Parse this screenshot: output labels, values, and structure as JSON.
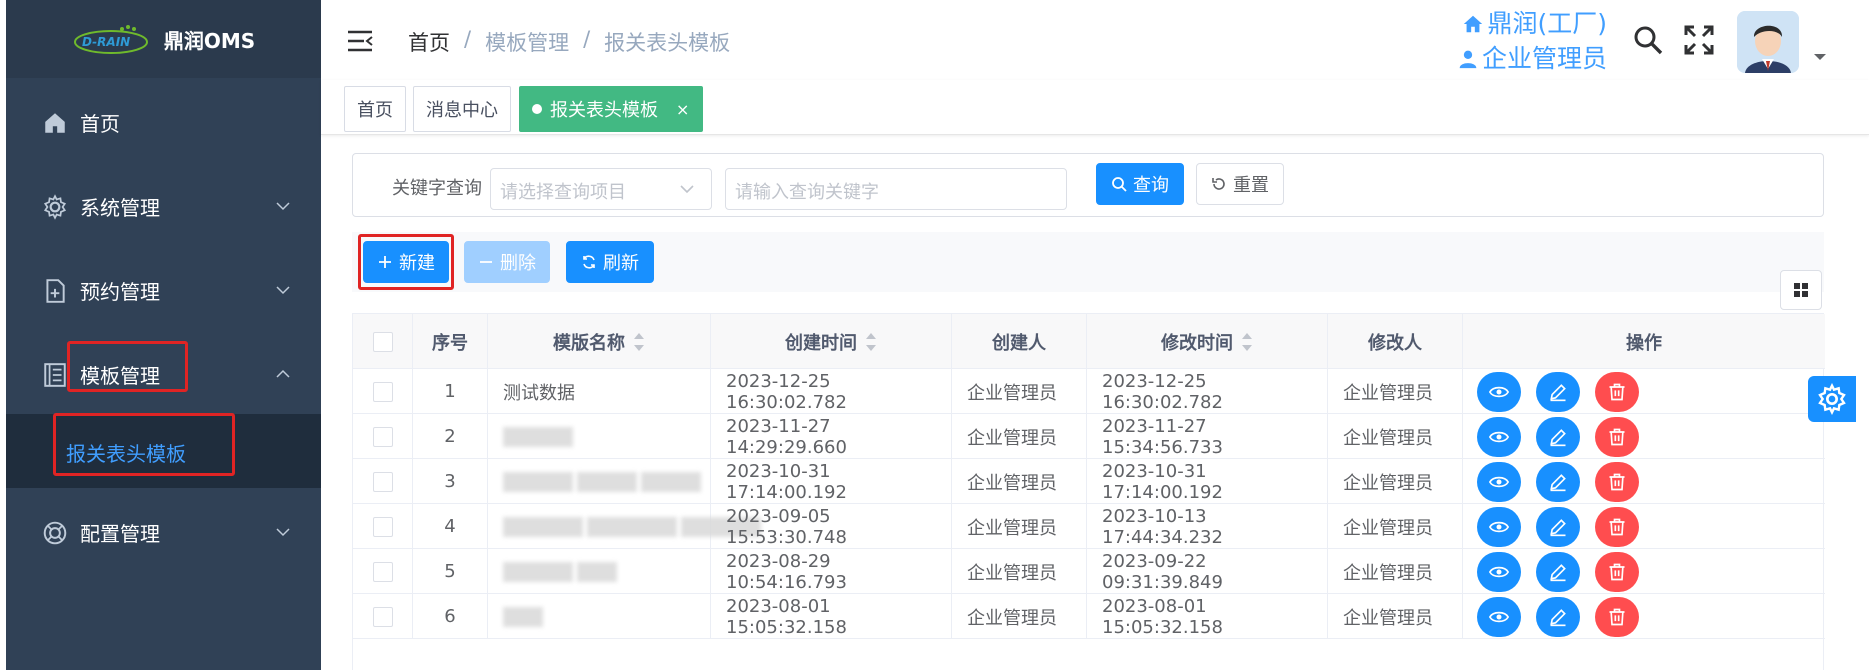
{
  "brand": {
    "logo_text": "D-RAIN",
    "app_name": "鼎润OMS"
  },
  "sidebar": {
    "items": [
      {
        "label": "首页",
        "icon": "home-icon"
      },
      {
        "label": "系统管理",
        "icon": "gear-icon"
      },
      {
        "label": "预约管理",
        "icon": "file-plus-icon"
      },
      {
        "label": "模板管理",
        "icon": "document-icon",
        "expanded": true
      },
      {
        "label": "配置管理",
        "icon": "config-icon"
      }
    ],
    "submenu": {
      "label": "报关表头模板",
      "active": true
    }
  },
  "header": {
    "breadcrumb": [
      "首页",
      "/",
      "模板管理",
      "/",
      "报关表头模板"
    ],
    "company": "鼎润(工厂)",
    "role": "企业管理员"
  },
  "tags": [
    {
      "label": "首页",
      "active": false
    },
    {
      "label": "消息中心",
      "active": false
    },
    {
      "label": "报关表头模板",
      "active": true,
      "close": "×"
    }
  ],
  "search": {
    "label": "关键字查询",
    "select_placeholder": "请选择查询项目",
    "input_placeholder": "请输入查询关键字",
    "query_label": "查询",
    "reset_label": "重置"
  },
  "toolbar": {
    "new_label": "新建",
    "delete_label": "删除",
    "refresh_label": "刷新"
  },
  "table": {
    "columns": [
      "",
      "序号",
      "模版名称",
      "创建时间",
      "创建人",
      "修改时间",
      "修改人",
      "操作"
    ],
    "rows": [
      {
        "index": "1",
        "name": "测试数据",
        "created": "2023-12-25 16:30:02.782",
        "creator": "企业管理员",
        "modified": "2023-12-25 16:30:02.782",
        "modifier": "企业管理员"
      },
      {
        "index": "2",
        "name": "",
        "created": "2023-11-27 14:29:29.660",
        "creator": "企业管理员",
        "modified": "2023-11-27 15:34:56.733",
        "modifier": "企业管理员"
      },
      {
        "index": "3",
        "name": "",
        "created": "2023-10-31 17:14:00.192",
        "creator": "企业管理员",
        "modified": "2023-10-31 17:14:00.192",
        "modifier": "企业管理员"
      },
      {
        "index": "4",
        "name": "",
        "created": "2023-09-05 15:53:30.748",
        "creator": "企业管理员",
        "modified": "2023-10-13 17:44:34.232",
        "modifier": "企业管理员"
      },
      {
        "index": "5",
        "name": "",
        "created": "2023-08-29 10:54:16.793",
        "creator": "企业管理员",
        "modified": "2023-09-22 09:31:39.849",
        "modifier": "企业管理员"
      },
      {
        "index": "6",
        "name": "",
        "created": "2023-08-01 15:05:32.158",
        "creator": "企业管理员",
        "modified": "2023-08-01 15:05:32.158",
        "modifier": "企业管理员"
      }
    ]
  },
  "colors": {
    "sidebar_bg": "#304156",
    "primary": "#1890ff",
    "danger": "#ff4d4f",
    "active_tag": "#42b983",
    "highlight_box": "#e02424"
  }
}
